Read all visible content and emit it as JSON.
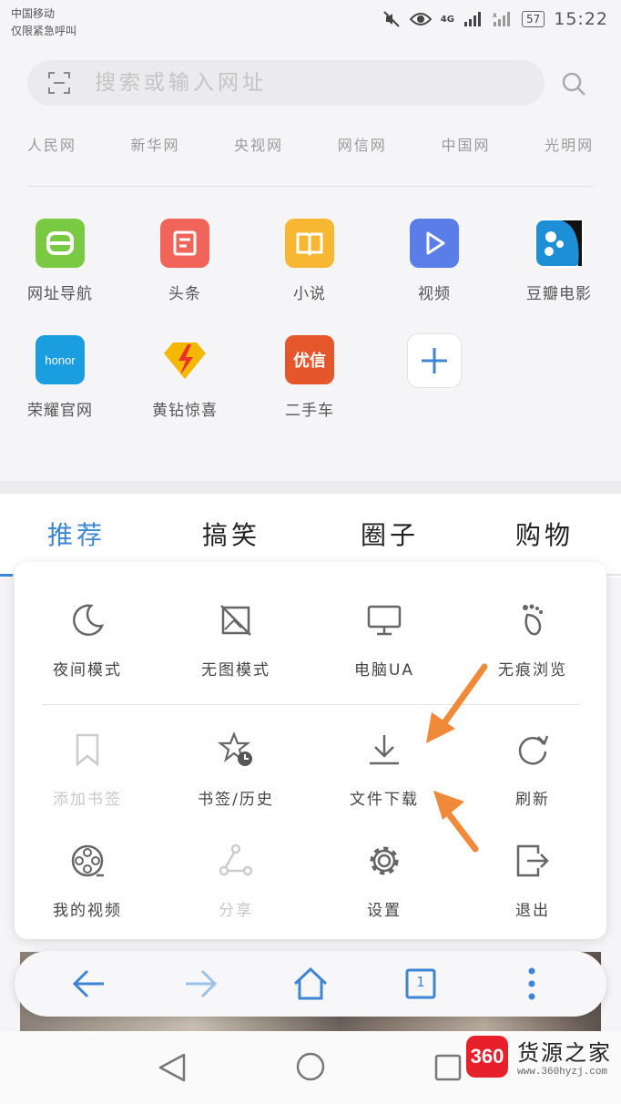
{
  "status_bar": {
    "carrier": "中国移动",
    "carrier_note": "仅限紧急呼叫",
    "network": "4G",
    "battery": "57",
    "time": "15:22"
  },
  "search": {
    "placeholder": "搜索或输入网址",
    "icons": [
      "scan-icon",
      "search-icon"
    ]
  },
  "quick_links": [
    "人民网",
    "新华网",
    "央视网",
    "网信网",
    "中国网",
    "光明网"
  ],
  "apps": [
    {
      "label": "网址导航",
      "icon": "e-nav-icon",
      "color": "#7ac943"
    },
    {
      "label": "头条",
      "icon": "news-icon",
      "color": "#f0645a"
    },
    {
      "label": "小说",
      "icon": "book-icon",
      "color": "#f7b733"
    },
    {
      "label": "视频",
      "icon": "play-icon",
      "color": "#5b7de8"
    },
    {
      "label": "豆瓣电影",
      "icon": "douban-icon",
      "color": "#1c8fd6"
    },
    {
      "label": "荣耀官网",
      "icon": "honor-icon",
      "color": "#1a9ee0"
    },
    {
      "label": "黄钻惊喜",
      "icon": "diamond-icon",
      "color": "#f5b800"
    },
    {
      "label": "二手车",
      "icon": "youxin-icon",
      "color": "#e5572b"
    },
    {
      "label": "",
      "icon": "add-icon",
      "color": "#3d86d6"
    }
  ],
  "honor_text": "honor",
  "youxin_text": "优信",
  "tabs": [
    {
      "label": "推荐",
      "active": true
    },
    {
      "label": "搞笑",
      "active": false
    },
    {
      "label": "圈子",
      "active": false
    },
    {
      "label": "购物",
      "active": false
    }
  ],
  "menu": {
    "row1": [
      {
        "label": "夜间模式",
        "icon": "moon-icon"
      },
      {
        "label": "无图模式",
        "icon": "no-image-icon"
      },
      {
        "label": "电脑UA",
        "icon": "monitor-icon"
      },
      {
        "label": "无痕浏览",
        "icon": "footprint-icon"
      }
    ],
    "row2": [
      {
        "label": "添加书签",
        "icon": "bookmark-icon",
        "disabled": true
      },
      {
        "label": "书签/历史",
        "icon": "star-clock-icon",
        "disabled": false
      },
      {
        "label": "文件下载",
        "icon": "download-icon",
        "disabled": false
      },
      {
        "label": "刷新",
        "icon": "refresh-icon",
        "disabled": false
      }
    ],
    "row3": [
      {
        "label": "我的视频",
        "icon": "film-reel-icon",
        "disabled": false
      },
      {
        "label": "分享",
        "icon": "share-icon",
        "disabled": true
      },
      {
        "label": "设置",
        "icon": "gear-icon",
        "disabled": false
      },
      {
        "label": "退出",
        "icon": "exit-icon",
        "disabled": false
      }
    ]
  },
  "toolbar": {
    "icons": [
      "back-arrow-icon",
      "forward-arrow-icon",
      "home-icon",
      "tabs-icon",
      "more-icon"
    ],
    "tab_count": "1"
  },
  "colors": {
    "accent": "#3d86d6",
    "annotation_arrow": "#f08a3a"
  },
  "watermark": {
    "badge": "360",
    "title": "货源之家",
    "url": "www.360hyzj.com"
  }
}
